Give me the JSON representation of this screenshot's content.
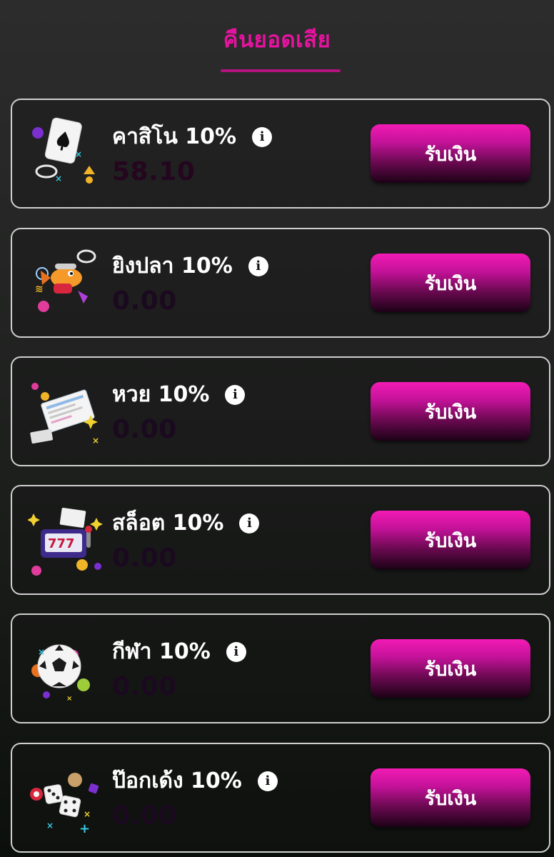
{
  "header": {
    "title": "คืนยอดเสีย"
  },
  "claim_label": "รับเงิน",
  "info_glyph": "i",
  "colors": {
    "accent": "#e6139f",
    "button_top": "#f21bb5",
    "button_bottom": "#1c0216",
    "card_border": "#cfcfcf"
  },
  "cards": [
    {
      "title": "คาสิโน 10%",
      "amount": "58.10",
      "icon": "playing-card-icon"
    },
    {
      "title": "ยิงปลา 10%",
      "amount": "0.00",
      "icon": "fish-shooter-icon"
    },
    {
      "title": "หวย 10%",
      "amount": "0.00",
      "icon": "lottery-ticket-icon"
    },
    {
      "title": "สล็อต 10%",
      "amount": "0.00",
      "icon": "slot-machine-icon"
    },
    {
      "title": "กีฬา 10%",
      "amount": "0.00",
      "icon": "soccer-ball-icon"
    },
    {
      "title": "ป๊อกเด้ง 10%",
      "amount": "0.00",
      "icon": "dice-icon"
    }
  ]
}
